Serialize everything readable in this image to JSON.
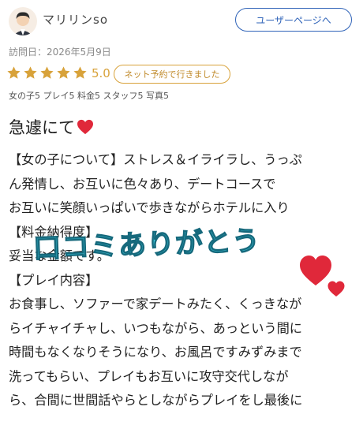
{
  "user": {
    "name": "マリリンso",
    "page_button": "ユーザーページへ"
  },
  "review": {
    "visit_date": "訪問日：2026年5月9日",
    "rating": "5.0",
    "stars": 5,
    "reservation_badge": "ネット予約で行きました",
    "scores": "女の子5 プレイ5 料金5 スタッフ5 写真5",
    "title": "急遽にて",
    "body_lines": [
      "【女の子について】ストレス＆イライラし、うっぷ",
      "ん発情し、お互いに色々あり、デートコースで",
      "お互いに笑顔いっぱいで歩きながらホテルに入り",
      "【料金納得度】",
      "妥当な金額です。",
      "【プレイ内容】",
      "お食事し、ソファーで家デートみたく、くっきなが",
      "らイチャイチャし、いつもながら、あっという間に",
      "時間もなくなりそうになり、お風呂ですみずみまで",
      "洗ってもらい、プレイもお互いに攻守交代しなが",
      "ら、合間に世間話やらとしながらプレイをし最後に"
    ],
    "sticker_text": "口コミありがとう"
  },
  "colors": {
    "accent_blue": "#2f63b8",
    "star_gold": "#d8a23a",
    "heart_red": "#e0283a",
    "sticker_cyan": "#3ccbe0"
  }
}
